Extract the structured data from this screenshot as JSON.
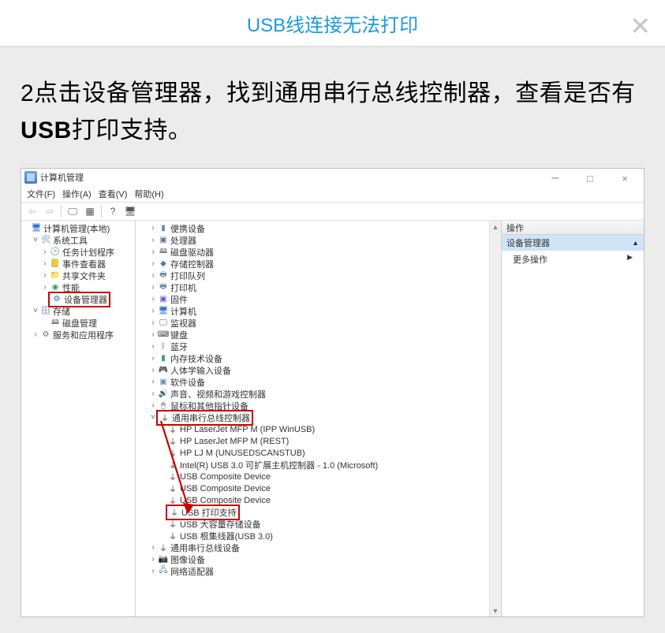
{
  "header": {
    "title": "USB线连接无法打印"
  },
  "instruction": {
    "prefix": "2点击设备管理器，找到通用串行总线控制器，查看是否有",
    "bold": "USB",
    "suffix": "打印支持。"
  },
  "dm_window": {
    "title": "计算机管理",
    "menus": {
      "file": "文件(F)",
      "action": "操作(A)",
      "view": "查看(V)",
      "help": "帮助(H)"
    },
    "left": {
      "root": "计算机管理(本地)",
      "sys_tools": "系统工具",
      "task": "任务计划程序",
      "event": "事件查看器",
      "shared": "共享文件夹",
      "perf": "性能",
      "devmgr": "设备管理器",
      "storage": "存储",
      "disk": "磁盘管理",
      "services": "服务和应用程序"
    },
    "mid": {
      "root_hidden_prefix": "",
      "portable": "便携设备",
      "cpu": "处理器",
      "diskdrv": "磁盘驱动器",
      "storectrl": "存储控制器",
      "printq": "打印队列",
      "printer": "打印机",
      "firmware": "固件",
      "computer": "计算机",
      "monitor": "监视器",
      "keyboard": "键盘",
      "bluetooth": "蓝牙",
      "memtech": "内存技术设备",
      "hid": "人体学输入设备",
      "softdev": "软件设备",
      "audio": "声音、视频和游戏控制器",
      "mouse": "鼠标和其他指针设备",
      "usbctrl": "通用串行总线控制器",
      "usb_items": {
        "hp1": "HP LaserJet MFP M            (IPP WinUSB)",
        "hp2": "HP LaserJet MFP M            (REST)",
        "hp3": "HP LJ M               (UNUSEDSCANSTUB)",
        "intel": "Intel(R) USB 3.0 可扩展主机控制器 - 1.0 (Microsoft)",
        "comp1": "USB Composite Device",
        "comp2": "USB Composite Device",
        "comp3": "USB Composite Device",
        "print": "USB 打印支持",
        "mass": "USB 大容量存储设备",
        "hub": "USB 根集线器(USB 3.0)"
      },
      "usbdev": "通用串行总线设备",
      "imgdev": "图像设备",
      "netadapter": "网络适配器"
    },
    "right": {
      "header": "操作",
      "selected": "设备管理器",
      "more": "更多操作"
    }
  }
}
